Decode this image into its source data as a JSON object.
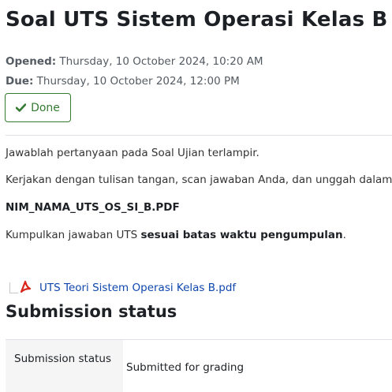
{
  "header": {
    "title": "Soal UTS Sistem Operasi Kelas B"
  },
  "dates": {
    "opened_label": "Opened:",
    "opened_value": "Thursday, 10 October 2024, 10:20 AM",
    "due_label": "Due:",
    "due_value": "Thursday, 10 October 2024, 12:00 PM"
  },
  "completion": {
    "icon": "check-icon",
    "label": "Done",
    "color": "#357a32"
  },
  "intro": {
    "line1": "Jawablah pertanyaan pada Soal Ujian terlampir.",
    "line2": "Kerjakan dengan tulisan tangan, scan jawaban Anda, dan unggah dalam",
    "line3": "NIM_NAMA_UTS_OS_SI_B.PDF",
    "line4_prefix": "Kumpulkan jawaban UTS ",
    "line4_bold": "sesuai batas waktu pengumpulan",
    "line4_suffix": "."
  },
  "attachment": {
    "icon": "pdf-icon",
    "filename": "UTS Teori Sistem Operasi Kelas B.pdf",
    "link_color": "#0f47ad"
  },
  "submission": {
    "section_title": "Submission status",
    "rows": [
      {
        "label": "Submission status",
        "value": "Submitted for grading"
      }
    ]
  }
}
